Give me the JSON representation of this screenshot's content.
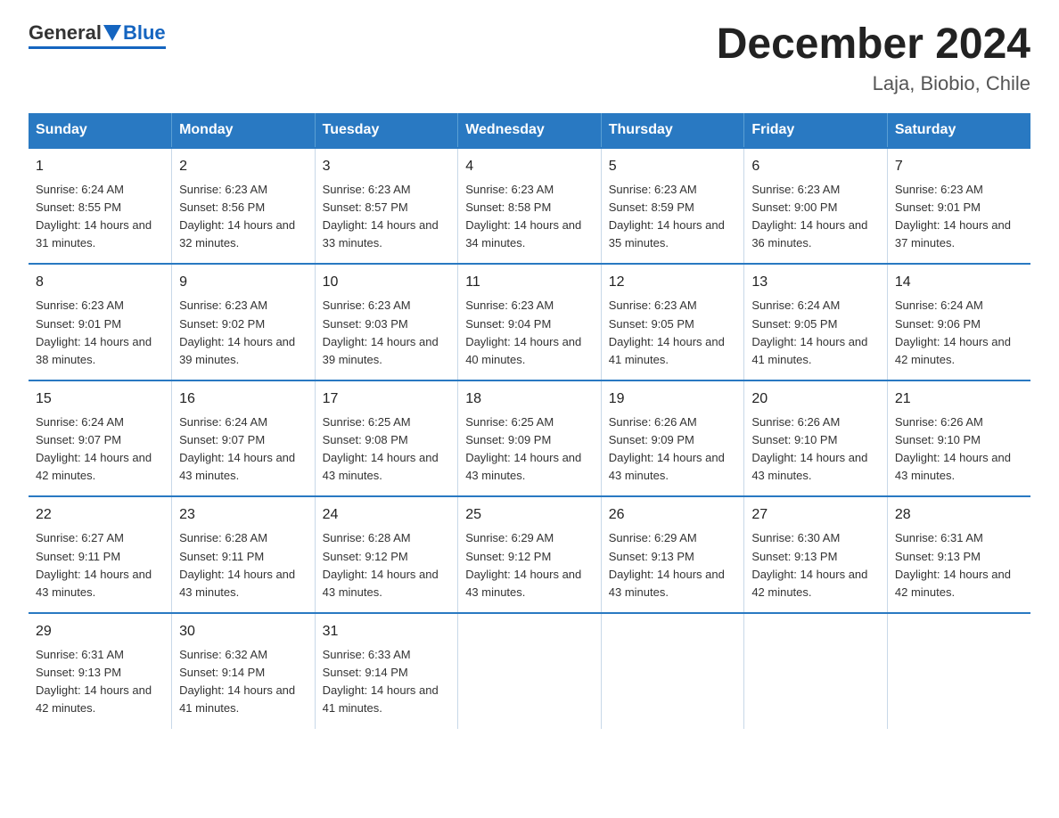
{
  "logo": {
    "general": "General",
    "blue": "Blue"
  },
  "title": "December 2024",
  "subtitle": "Laja, Biobio, Chile",
  "weekdays": [
    "Sunday",
    "Monday",
    "Tuesday",
    "Wednesday",
    "Thursday",
    "Friday",
    "Saturday"
  ],
  "weeks": [
    [
      {
        "day": "1",
        "sunrise": "6:24 AM",
        "sunset": "8:55 PM",
        "daylight": "14 hours and 31 minutes."
      },
      {
        "day": "2",
        "sunrise": "6:23 AM",
        "sunset": "8:56 PM",
        "daylight": "14 hours and 32 minutes."
      },
      {
        "day": "3",
        "sunrise": "6:23 AM",
        "sunset": "8:57 PM",
        "daylight": "14 hours and 33 minutes."
      },
      {
        "day": "4",
        "sunrise": "6:23 AM",
        "sunset": "8:58 PM",
        "daylight": "14 hours and 34 minutes."
      },
      {
        "day": "5",
        "sunrise": "6:23 AM",
        "sunset": "8:59 PM",
        "daylight": "14 hours and 35 minutes."
      },
      {
        "day": "6",
        "sunrise": "6:23 AM",
        "sunset": "9:00 PM",
        "daylight": "14 hours and 36 minutes."
      },
      {
        "day": "7",
        "sunrise": "6:23 AM",
        "sunset": "9:01 PM",
        "daylight": "14 hours and 37 minutes."
      }
    ],
    [
      {
        "day": "8",
        "sunrise": "6:23 AM",
        "sunset": "9:01 PM",
        "daylight": "14 hours and 38 minutes."
      },
      {
        "day": "9",
        "sunrise": "6:23 AM",
        "sunset": "9:02 PM",
        "daylight": "14 hours and 39 minutes."
      },
      {
        "day": "10",
        "sunrise": "6:23 AM",
        "sunset": "9:03 PM",
        "daylight": "14 hours and 39 minutes."
      },
      {
        "day": "11",
        "sunrise": "6:23 AM",
        "sunset": "9:04 PM",
        "daylight": "14 hours and 40 minutes."
      },
      {
        "day": "12",
        "sunrise": "6:23 AM",
        "sunset": "9:05 PM",
        "daylight": "14 hours and 41 minutes."
      },
      {
        "day": "13",
        "sunrise": "6:24 AM",
        "sunset": "9:05 PM",
        "daylight": "14 hours and 41 minutes."
      },
      {
        "day": "14",
        "sunrise": "6:24 AM",
        "sunset": "9:06 PM",
        "daylight": "14 hours and 42 minutes."
      }
    ],
    [
      {
        "day": "15",
        "sunrise": "6:24 AM",
        "sunset": "9:07 PM",
        "daylight": "14 hours and 42 minutes."
      },
      {
        "day": "16",
        "sunrise": "6:24 AM",
        "sunset": "9:07 PM",
        "daylight": "14 hours and 43 minutes."
      },
      {
        "day": "17",
        "sunrise": "6:25 AM",
        "sunset": "9:08 PM",
        "daylight": "14 hours and 43 minutes."
      },
      {
        "day": "18",
        "sunrise": "6:25 AM",
        "sunset": "9:09 PM",
        "daylight": "14 hours and 43 minutes."
      },
      {
        "day": "19",
        "sunrise": "6:26 AM",
        "sunset": "9:09 PM",
        "daylight": "14 hours and 43 minutes."
      },
      {
        "day": "20",
        "sunrise": "6:26 AM",
        "sunset": "9:10 PM",
        "daylight": "14 hours and 43 minutes."
      },
      {
        "day": "21",
        "sunrise": "6:26 AM",
        "sunset": "9:10 PM",
        "daylight": "14 hours and 43 minutes."
      }
    ],
    [
      {
        "day": "22",
        "sunrise": "6:27 AM",
        "sunset": "9:11 PM",
        "daylight": "14 hours and 43 minutes."
      },
      {
        "day": "23",
        "sunrise": "6:28 AM",
        "sunset": "9:11 PM",
        "daylight": "14 hours and 43 minutes."
      },
      {
        "day": "24",
        "sunrise": "6:28 AM",
        "sunset": "9:12 PM",
        "daylight": "14 hours and 43 minutes."
      },
      {
        "day": "25",
        "sunrise": "6:29 AM",
        "sunset": "9:12 PM",
        "daylight": "14 hours and 43 minutes."
      },
      {
        "day": "26",
        "sunrise": "6:29 AM",
        "sunset": "9:13 PM",
        "daylight": "14 hours and 43 minutes."
      },
      {
        "day": "27",
        "sunrise": "6:30 AM",
        "sunset": "9:13 PM",
        "daylight": "14 hours and 42 minutes."
      },
      {
        "day": "28",
        "sunrise": "6:31 AM",
        "sunset": "9:13 PM",
        "daylight": "14 hours and 42 minutes."
      }
    ],
    [
      {
        "day": "29",
        "sunrise": "6:31 AM",
        "sunset": "9:13 PM",
        "daylight": "14 hours and 42 minutes."
      },
      {
        "day": "30",
        "sunrise": "6:32 AM",
        "sunset": "9:14 PM",
        "daylight": "14 hours and 41 minutes."
      },
      {
        "day": "31",
        "sunrise": "6:33 AM",
        "sunset": "9:14 PM",
        "daylight": "14 hours and 41 minutes."
      },
      null,
      null,
      null,
      null
    ]
  ]
}
